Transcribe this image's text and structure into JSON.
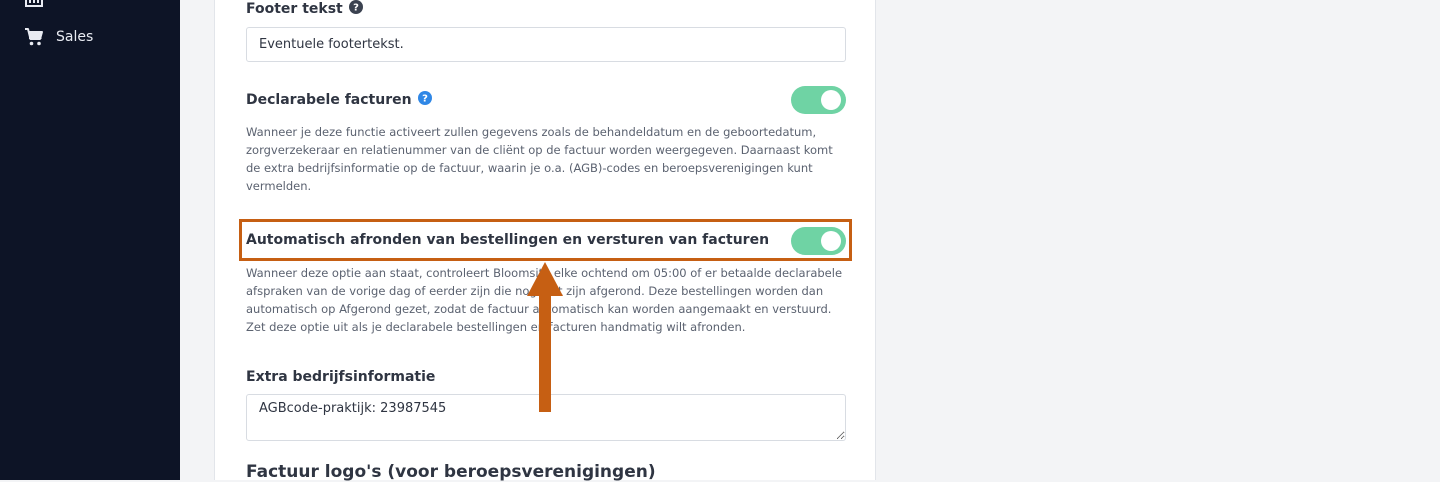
{
  "sidebar": {
    "items": [
      {
        "label": "",
        "icon": "chart-icon"
      },
      {
        "label": "Sales",
        "icon": "cart-icon"
      }
    ]
  },
  "form": {
    "footer_label": "Footer tekst",
    "footer_value": "Eventuele footertekst.",
    "declarable_label": "Declarabele facturen",
    "declarable_on": true,
    "declarable_desc": "Wanneer je deze functie activeert zullen gegevens zoals de behandeldatum en de geboortedatum, zorgverzekeraar en relatienummer van de cliënt op de factuur worden weergegeven. Daarnaast komt de extra bedrijfsinformatie op de factuur, waarin je o.a. (AGB)-codes en beroepsverenigingen kunt vermelden.",
    "auto_label": "Automatisch afronden van bestellingen en versturen van facturen",
    "auto_on": true,
    "auto_desc": "Wanneer deze optie aan staat, controleert Bloomsite elke ochtend om 05:00 of er betaalde declarabele afspraken van de vorige dag of eerder zijn die nog niet zijn afgerond. Deze bestellingen worden dan automatisch op Afgerond gezet, zodat de factuur automatisch kan worden aangemaakt en verstuurd. Zet deze optie uit als je declarabele bestellingen en facturen handmatig wilt afronden.",
    "extra_label": "Extra bedrijfsinformatie",
    "extra_value": "AGBcode-praktijk: 23987545",
    "logos_title": "Factuur logo's (voor beroepsverenigingen)"
  },
  "colors": {
    "sidebar_bg": "#0d1426",
    "toggle_on": "#6fd3a4",
    "highlight": "#c65f13",
    "help_blue": "#2f87e6"
  }
}
